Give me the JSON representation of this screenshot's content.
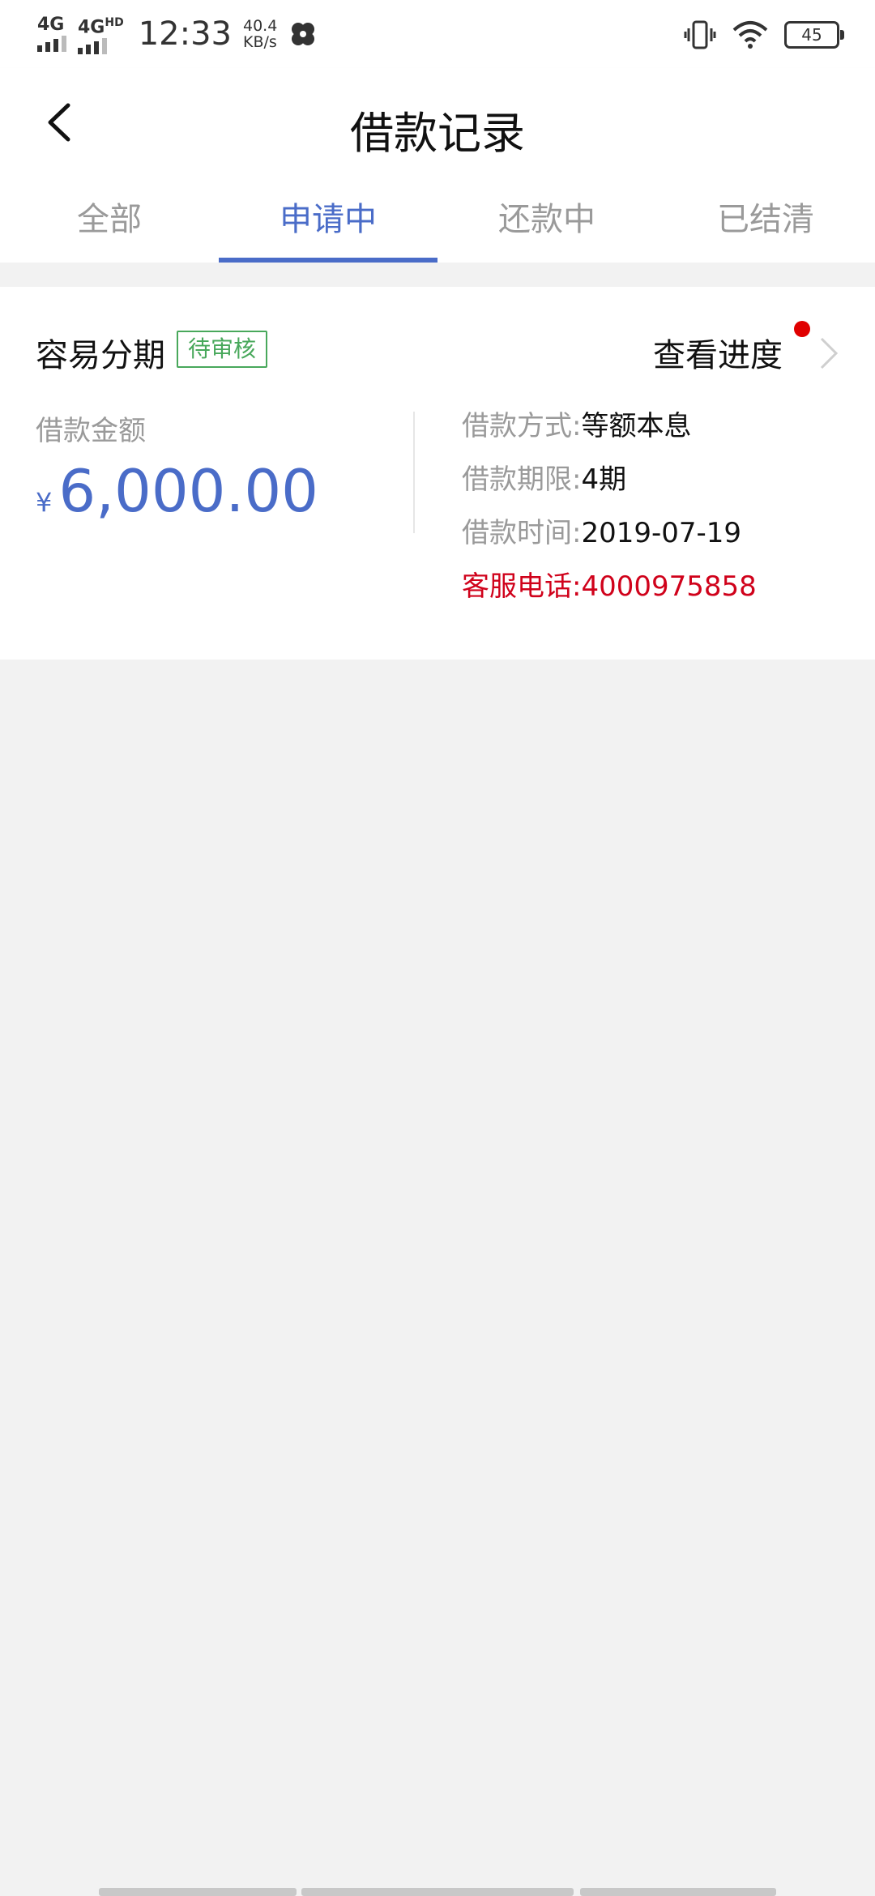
{
  "status_bar": {
    "network1": "4G",
    "network2": "4G",
    "network2_sup": "HD",
    "time": "12:33",
    "speed_value": "40.4",
    "speed_unit": "KB/s",
    "battery": "45"
  },
  "header": {
    "title": "借款记录"
  },
  "tabs": [
    {
      "label": "全部",
      "active": false
    },
    {
      "label": "申请中",
      "active": true
    },
    {
      "label": "还款中",
      "active": false
    },
    {
      "label": "已结清",
      "active": false
    }
  ],
  "loan_card": {
    "product_name": "容易分期",
    "status_badge": "待审核",
    "progress_link": "查看进度",
    "amount_label": "借款金额",
    "currency_symbol": "¥",
    "amount": "6,000.00",
    "details": [
      {
        "key": "借款方式:",
        "value": "等额本息"
      },
      {
        "key": "借款期限:",
        "value": "4期"
      },
      {
        "key": "借款时间:",
        "value": "2019-07-19"
      },
      {
        "key": "客服电话:",
        "value": "4000975858"
      }
    ]
  },
  "colors": {
    "accent": "#4a6cc8",
    "status_green": "#48a85b",
    "alert_red": "#d0021b",
    "background": "#f2f2f2"
  }
}
